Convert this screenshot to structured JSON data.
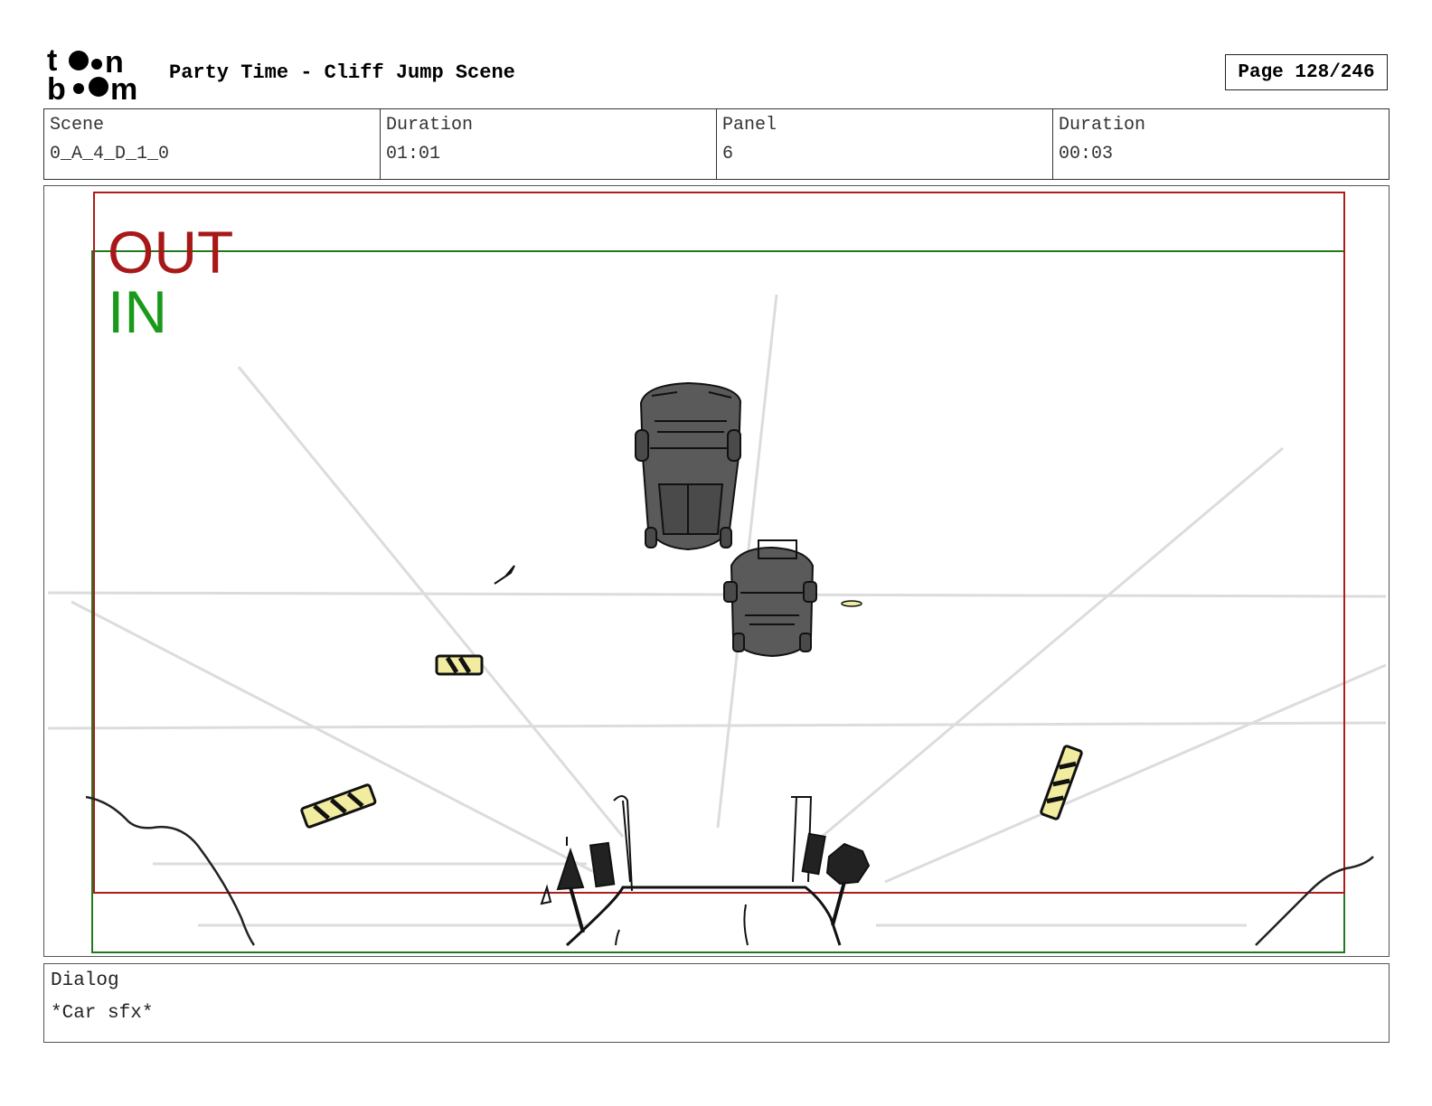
{
  "header": {
    "title": "Party Time - Cliff Jump Scene",
    "page": "Page 128/246",
    "logo_icon": "toon-boom-logo"
  },
  "info": {
    "scene_label": "Scene",
    "scene_value": "0_A_4_D_1_0",
    "scene_duration_label": "Duration",
    "scene_duration_value": "01:01",
    "panel_label": "Panel",
    "panel_value": "6",
    "panel_duration_label": "Duration",
    "panel_duration_value": "00:03"
  },
  "frame": {
    "out_label": "OUT",
    "in_label": "IN",
    "out_color": "#a81818",
    "in_color": "#1a9a1a"
  },
  "dialog": {
    "label": "Dialog",
    "text": "*Car sfx*"
  }
}
